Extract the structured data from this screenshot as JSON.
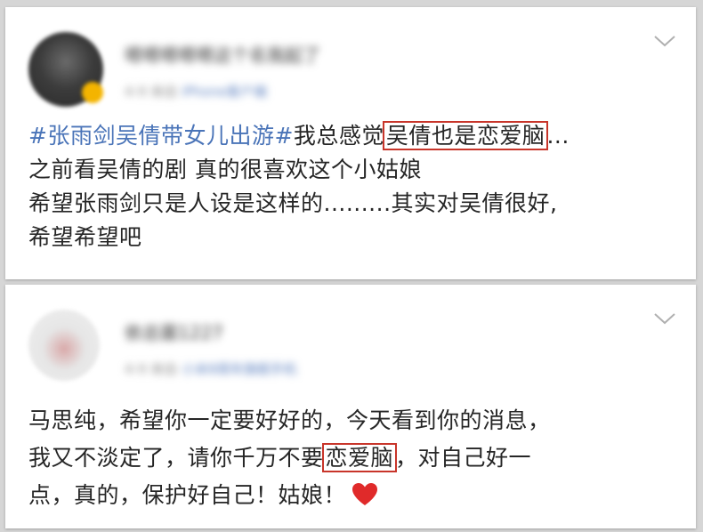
{
  "posts": [
    {
      "author": "嗯嗯嗯嗯嗯这个名我起了",
      "meta_time": "4-9",
      "meta_from": "来自",
      "meta_source": "iPhone客户端",
      "line1_tag": "#张雨剑吴倩带女儿出游#",
      "line1_pre": "我总感觉",
      "line1_highlight": "吴倩也是恋爱脑",
      "line1_post": "...",
      "line2": "之前看吴倩的剧 真的很喜欢这个小姑娘",
      "line3": "希望张雨剑只是人设是这样的.........其实对吴倩很好,",
      "line4": "希望希望吧"
    },
    {
      "author": "依总菌1227",
      "meta_time": "4-9",
      "meta_from": "来自",
      "meta_source": "小米8周年旗舰手机",
      "line1": "马思纯，希望你一定要好好的，今天看到你的消息，",
      "line2_pre": "我又不淡定了，请你千万不要",
      "line2_highlight": "恋爱脑",
      "line2_post": "，对自己好一",
      "line3": "点，真的，保护好自己！姑娘！"
    }
  ],
  "icons": {
    "expand": "chevron-down-icon",
    "emoji": "heart-icon"
  },
  "colors": {
    "topic_link": "#4a74b8",
    "highlight_box": "#c8352a",
    "heart": "#e02a2a"
  }
}
